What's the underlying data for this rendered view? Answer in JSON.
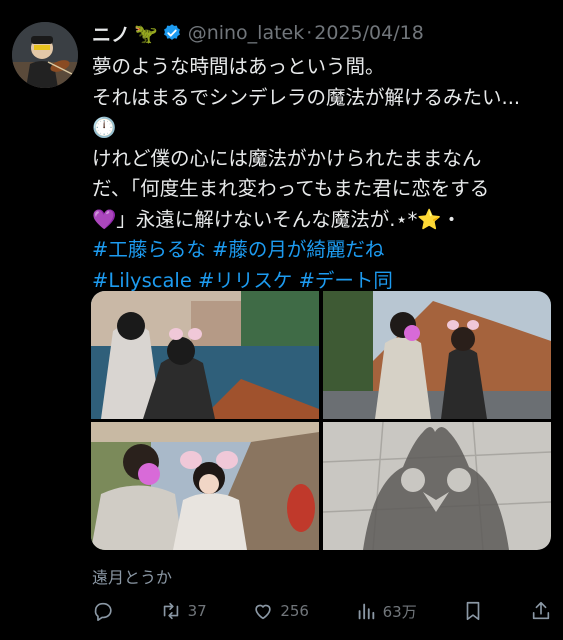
{
  "post": {
    "author_name": "ニノ",
    "author_emoji": "🦖",
    "handle": "@nino_latek",
    "separator": "·",
    "date": "2025/04/18",
    "lines": [
      "夢のような時間はあっという間。",
      "それはまるでシンデレラの魔法が解けるみたい...",
      "🕛",
      "けれど僕の心には魔法がかけられたままなん",
      "だ、「何度生まれ変わってもまた君に恋をする",
      "💜」永遠に解けないそんな魔法が.⋆*⭐️・"
    ],
    "hashtags_line1": [
      "#工藤らるな",
      "#藤の月が綺麗だね"
    ],
    "hashtags_line2": [
      "#Lilyscale",
      "#リリスケ",
      "#デート同"
    ],
    "photo_credit": "遠月とうか"
  },
  "actions": {
    "reply_icon": "reply-icon",
    "retweet_count": "37",
    "like_count": "256",
    "views_count": "63万",
    "bookmark_icon": "bookmark-icon",
    "share_icon": "share-icon"
  },
  "colors": {
    "background": "#000000",
    "text": "#e7e9ea",
    "muted": "#71767b",
    "link": "#1d9bf0",
    "verified": "#1d9bf0"
  }
}
